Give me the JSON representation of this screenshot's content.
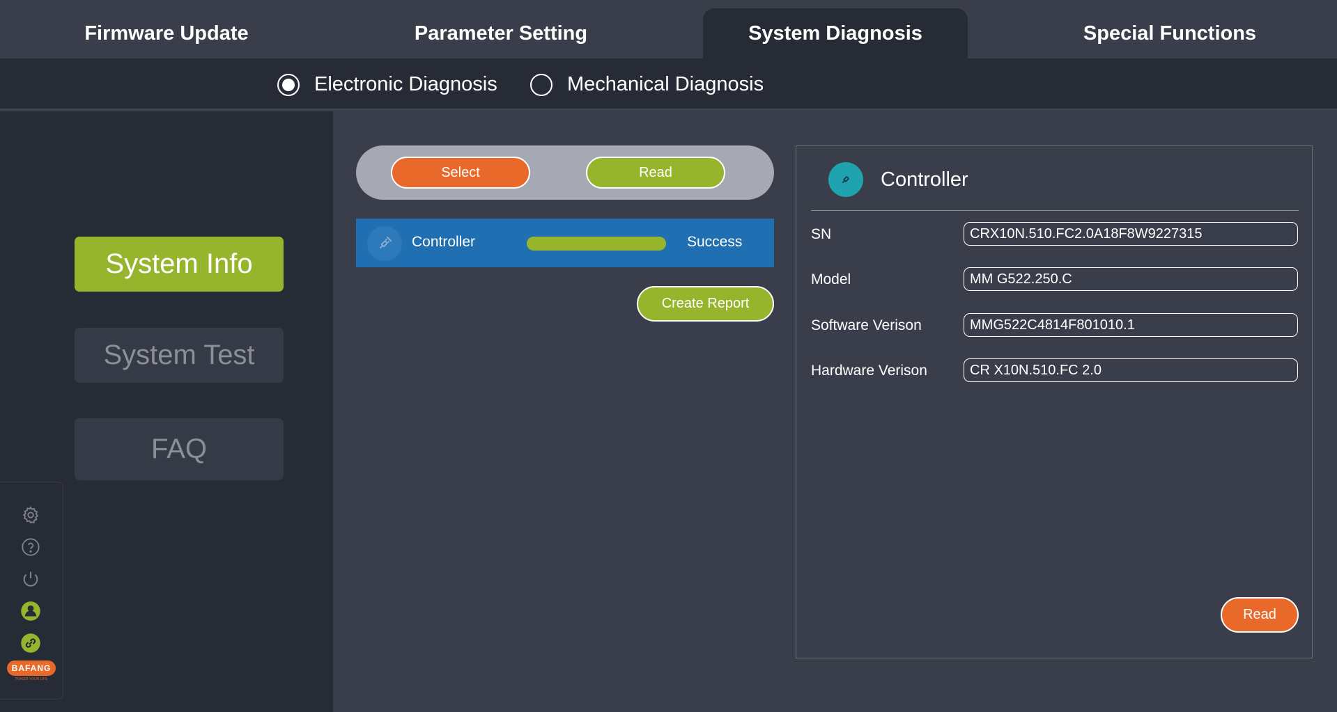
{
  "tabs": [
    {
      "label": "Firmware Update",
      "active": false
    },
    {
      "label": "Parameter Setting",
      "active": false
    },
    {
      "label": "System Diagnosis",
      "active": true
    },
    {
      "label": "Special Functions",
      "active": false
    }
  ],
  "diagnosis_mode": {
    "options": [
      {
        "label": "Electronic Diagnosis",
        "selected": true
      },
      {
        "label": "Mechanical Diagnosis",
        "selected": false
      }
    ]
  },
  "sidebar": {
    "items": [
      {
        "label": "System Info",
        "active": true
      },
      {
        "label": "System Test",
        "active": false
      },
      {
        "label": "FAQ",
        "active": false
      }
    ],
    "icons": [
      "gear-icon",
      "help-icon",
      "power-icon",
      "user-icon",
      "link-icon"
    ],
    "logo": {
      "brand": "BAFANG",
      "tagline": "POWER YOUR LIFE"
    }
  },
  "actions": {
    "select_label": "Select",
    "read_label": "Read",
    "create_report_label": "Create Report"
  },
  "device_list": [
    {
      "name": "Controller",
      "progress": 1.0,
      "status": "Success",
      "icon": "plug-icon"
    }
  ],
  "details": {
    "title": "Controller",
    "icon": "plug-icon",
    "fields": [
      {
        "label": "SN",
        "value": "CRX10N.510.FC2.0A18F8W9227315"
      },
      {
        "label": "Model",
        "value": "MM G522.250.C"
      },
      {
        "label": "Software Verison",
        "value": "MMG522C4814F801010.1"
      },
      {
        "label": "Hardware Verison",
        "value": "CR X10N.510.FC 2.0"
      }
    ],
    "read_label": "Read"
  },
  "colors": {
    "accent_green": "#97b42d",
    "accent_orange": "#e8692a",
    "row_blue": "#1f6fb2",
    "teal": "#1fa3b1",
    "bg": "#3a3e4a",
    "bg_dark": "#272b36"
  }
}
